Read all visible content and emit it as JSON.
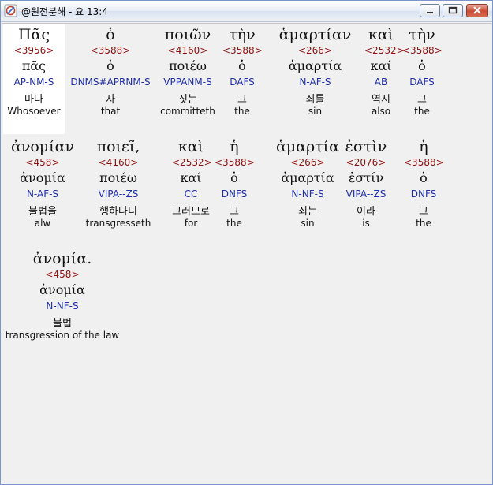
{
  "window": {
    "title": "@원전분해 - 요 13:4",
    "buttons": [
      "minimize-icon",
      "maximize-icon",
      "close-icon"
    ],
    "accent": "#d95b43"
  },
  "colors": {
    "strong": "#8b1010",
    "parse": "#1f2fa8",
    "selected_bg": "#ffffff"
  },
  "lines": [
    [
      {
        "greek": "Πᾶς",
        "strong": "<3956>",
        "lemma": "πᾶς",
        "parse": "AP-NM-S",
        "korean": "마다",
        "english": "Whosoever",
        "selected": true
      },
      {
        "greek": "ὁ",
        "strong": "<3588>",
        "lemma": "ὁ",
        "parse": "DNMS#APRNM-S",
        "korean": "자",
        "english": "that"
      },
      {
        "greek": "ποιῶν",
        "strong": "<4160>",
        "lemma": "ποιέω",
        "parse": "VPPANM-S",
        "korean": "짓는",
        "english": "committeth"
      },
      {
        "greek": "τὴν",
        "strong": "<3588>",
        "lemma": "ὁ",
        "parse": "DAFS",
        "korean": "그",
        "english": "the"
      },
      {
        "greek": "ἁμαρτίαν",
        "strong": "<266>",
        "lemma": "ἁμαρτία",
        "parse": "N-AF-S",
        "korean": "죄를",
        "english": "sin"
      },
      {
        "greek": "καὶ",
        "strong": "<2532>",
        "lemma": "καί",
        "parse": "AB",
        "korean": "역시",
        "english": "also"
      },
      {
        "greek": "τὴν",
        "strong": "<3588>",
        "lemma": "ὁ",
        "parse": "DAFS",
        "korean": "그",
        "english": "the"
      }
    ],
    [
      {
        "greek": "ἀνομίαν",
        "strong": "<458>",
        "lemma": "ἀνομία",
        "parse": "N-AF-S",
        "korean": "불법을",
        "english": "alw"
      },
      {
        "greek": "ποιεῖ,",
        "strong": "<4160>",
        "lemma": "ποιέω",
        "parse": "VIPA--ZS",
        "korean": "행하나니",
        "english": "transgresseth"
      },
      {
        "greek": "καὶ",
        "strong": "<2532>",
        "lemma": "καί",
        "parse": "CC",
        "korean": "그러므로",
        "english": "for"
      },
      {
        "greek": "ἡ",
        "strong": "<3588>",
        "lemma": "ὁ",
        "parse": "DNFS",
        "korean": "그",
        "english": "the"
      },
      {
        "greek": "ἁμαρτία",
        "strong": "<266>",
        "lemma": "ἁμαρτία",
        "parse": "N-NF-S",
        "korean": "죄는",
        "english": "sin"
      },
      {
        "greek": "ἐστὶν",
        "strong": "<2076>",
        "lemma": "ἐστίν",
        "parse": "VIPA--ZS",
        "korean": "이라",
        "english": "is"
      },
      {
        "greek": "ἡ",
        "strong": "<3588>",
        "lemma": "ὁ",
        "parse": "DNFS",
        "korean": "그",
        "english": "the"
      }
    ],
    [
      {
        "greek": "ἀνομία.",
        "strong": "<458>",
        "lemma": "ἀνομία",
        "parse": "N-NF-S",
        "korean": "불법",
        "english": "transgression of the law"
      }
    ]
  ]
}
